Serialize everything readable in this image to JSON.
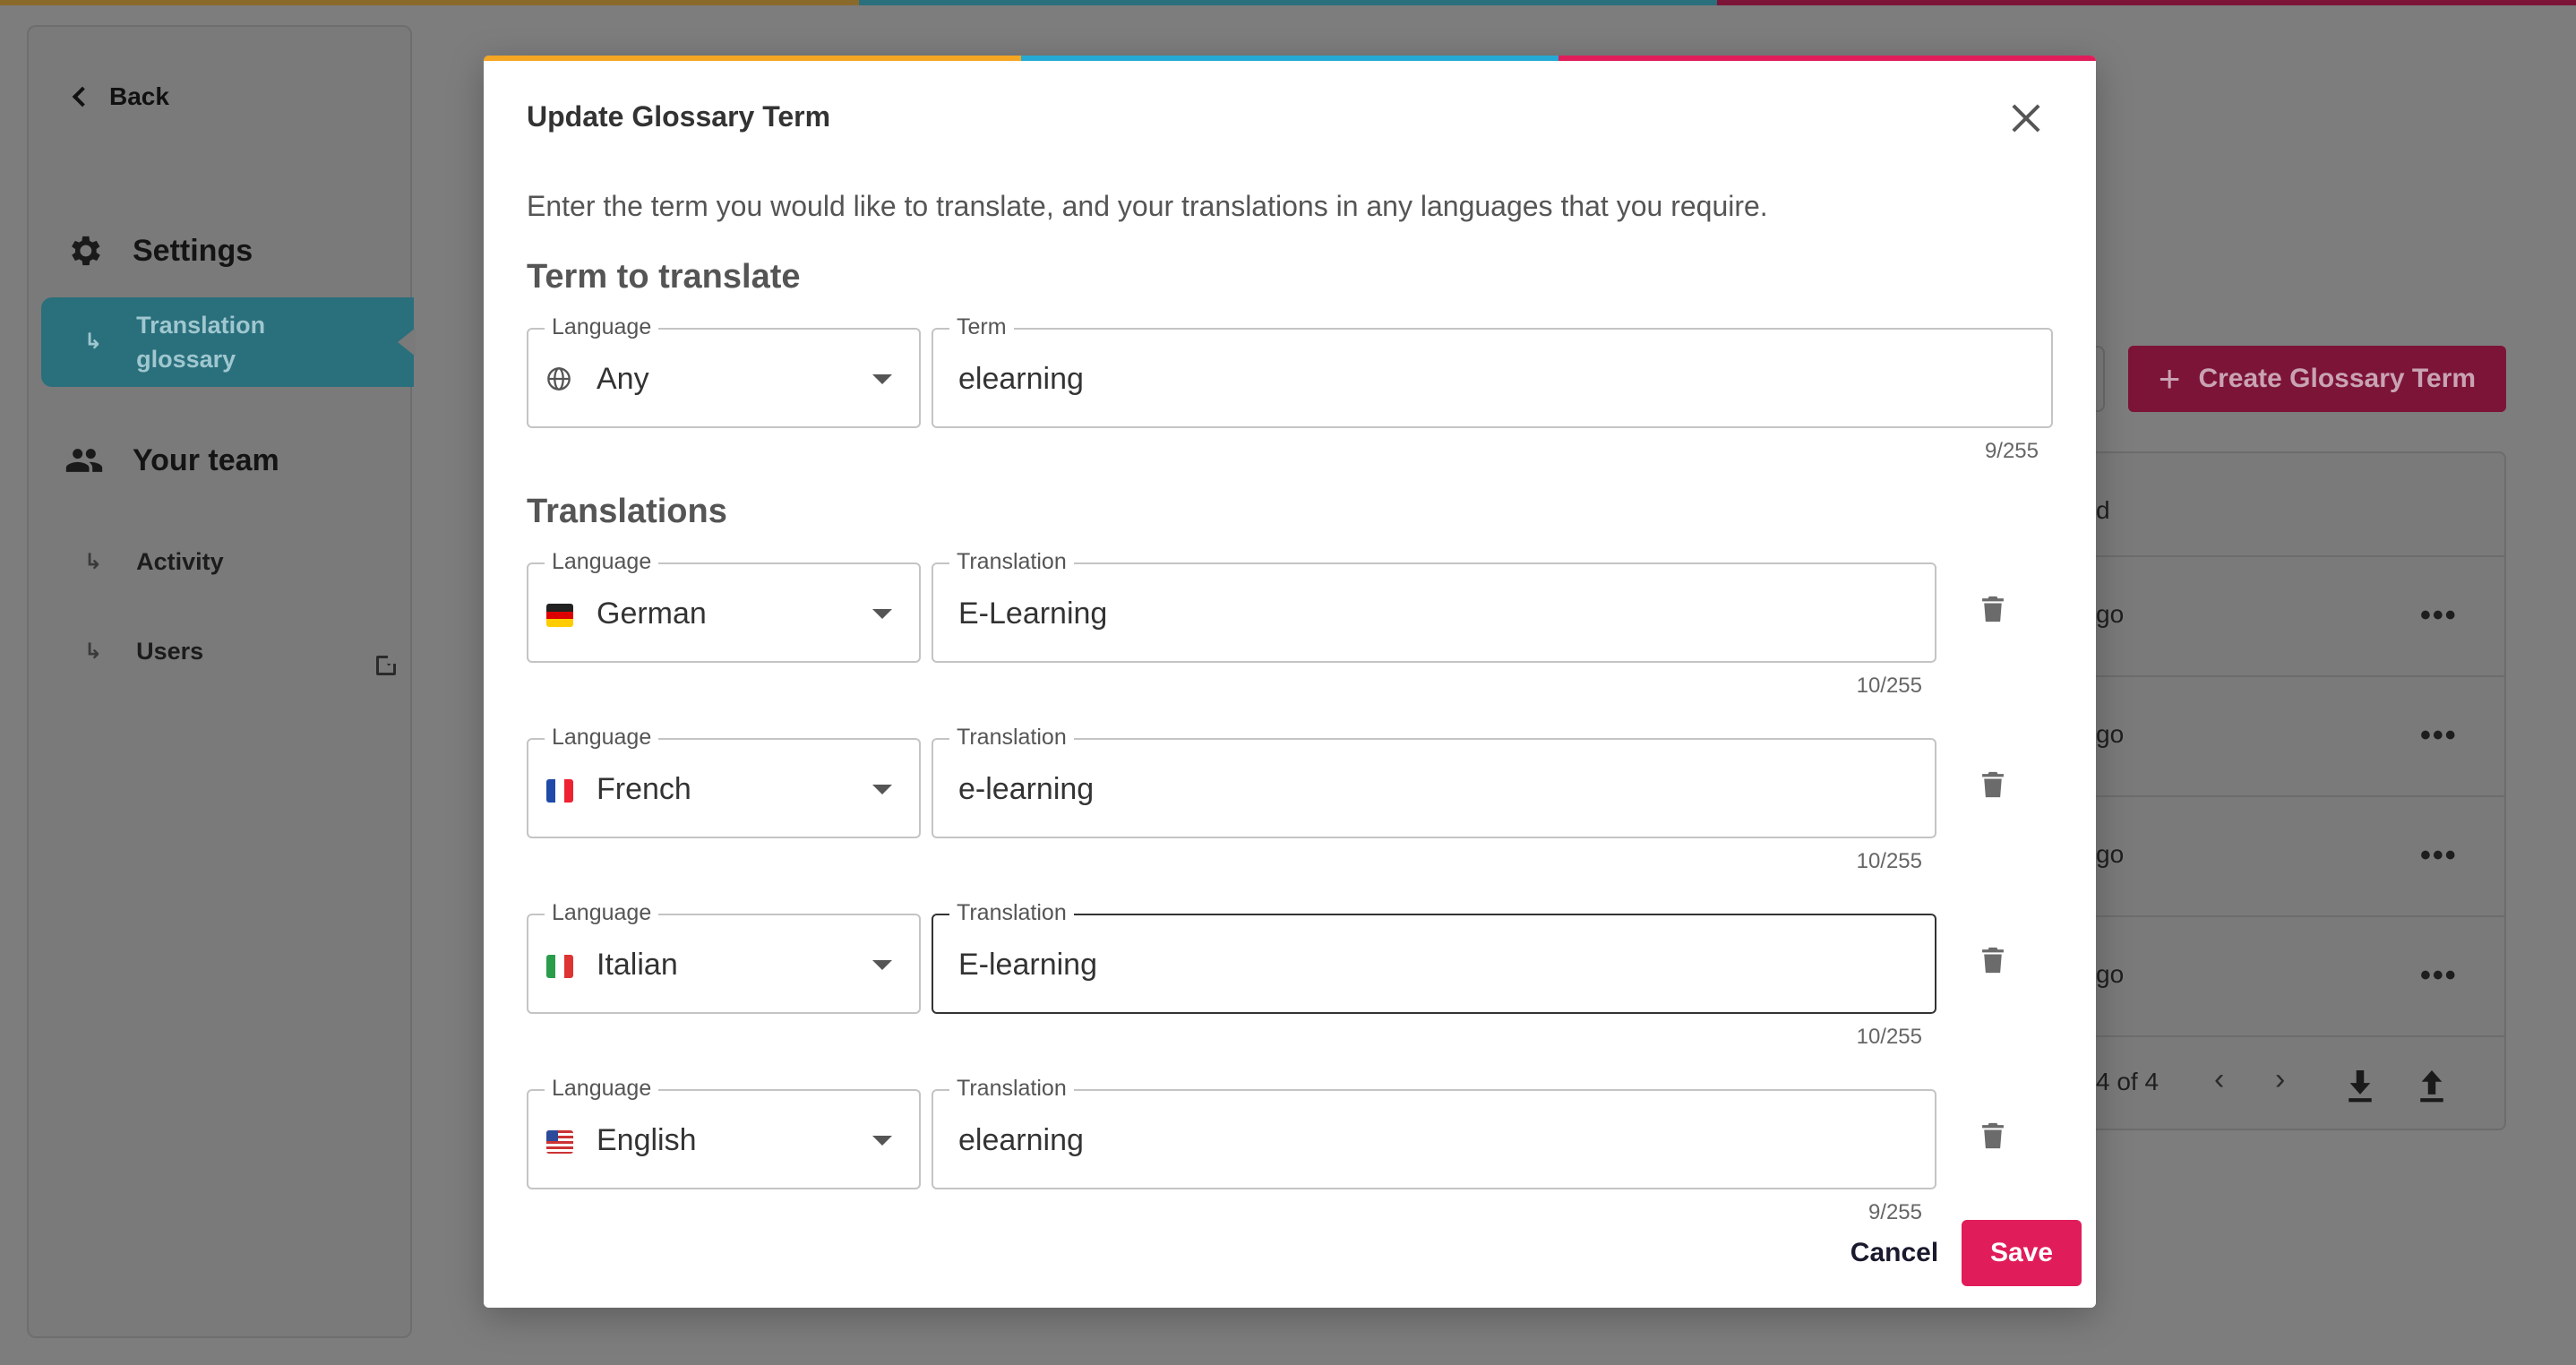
{
  "colors": {
    "accent_orange": "#f5a623",
    "accent_blue": "#24aad4",
    "accent_pink": "#e01d5a",
    "sidebar_active": "#2a6f7c",
    "save_button": "#e01d5a"
  },
  "sidebar": {
    "back_label": "Back",
    "settings_label": "Settings",
    "active_item_line1": "Translation",
    "active_item_line2": "glossary",
    "team_label": "Your team",
    "activity_label": "Activity",
    "users_label": "Users"
  },
  "background": {
    "create_button_label": "Create Glossary Term",
    "header_partial": "d",
    "rows": [
      "go",
      "go",
      "go",
      "go"
    ],
    "row_menu": "•••",
    "pagination": "4 of 4"
  },
  "modal": {
    "title": "Update Glossary Term",
    "intro": "Enter the term you would like to translate, and your translations in any languages that you require.",
    "term_section_heading": "Term to translate",
    "term": {
      "language_legend": "Language",
      "language_value": "Any",
      "term_legend": "Term",
      "term_value": "elearning",
      "counter": "9/255"
    },
    "translations_heading": "Translations",
    "translations": [
      {
        "language_legend": "Language",
        "language": "German",
        "flag": "de-flag-icon",
        "translation_legend": "Translation",
        "value": "E-Learning",
        "counter": "10/255"
      },
      {
        "language_legend": "Language",
        "language": "French",
        "flag": "fr-flag-icon",
        "translation_legend": "Translation",
        "value": "e-learning",
        "counter": "10/255"
      },
      {
        "language_legend": "Language",
        "language": "Italian",
        "flag": "it-flag-icon",
        "translation_legend": "Translation",
        "value": "E-learning",
        "counter": "10/255"
      },
      {
        "language_legend": "Language",
        "language": "English",
        "flag": "us-flag-icon",
        "translation_legend": "Translation",
        "value": "elearning",
        "counter": "9/255"
      }
    ],
    "cancel_label": "Cancel",
    "save_label": "Save"
  }
}
